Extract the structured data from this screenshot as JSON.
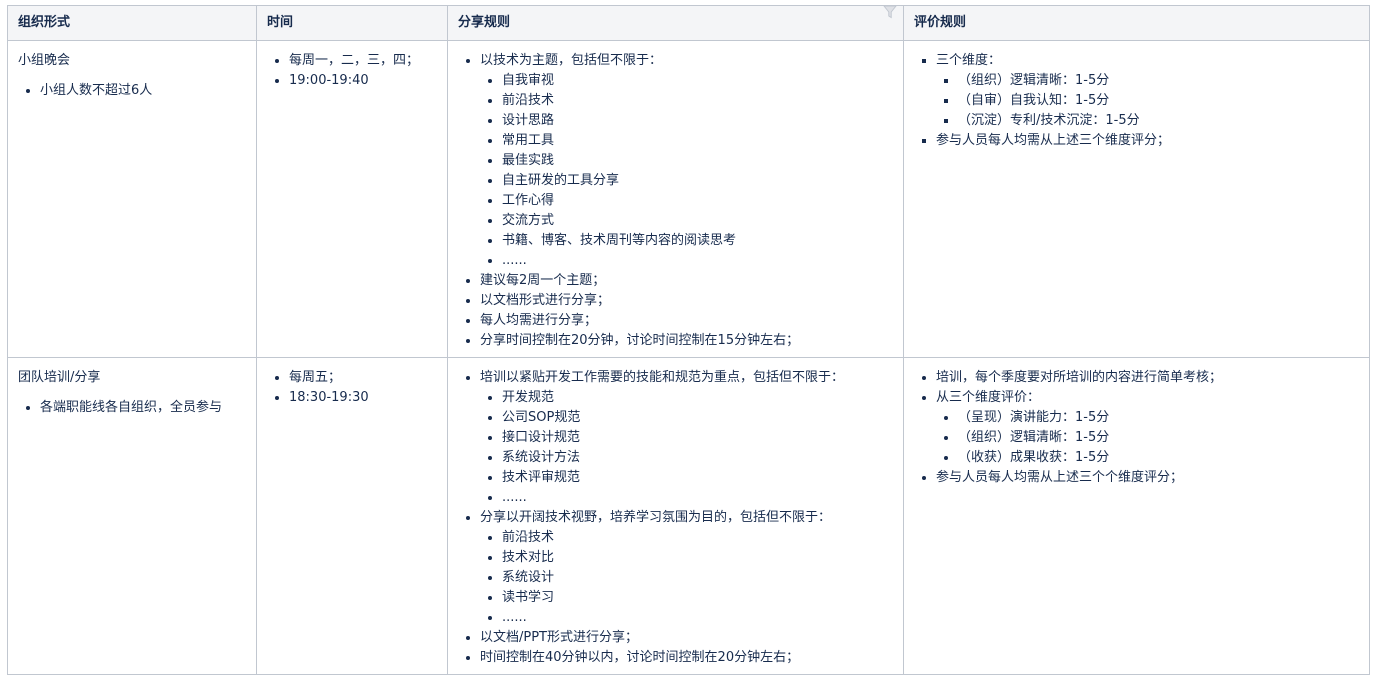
{
  "headers": {
    "col1": "组织形式",
    "col2": "时间",
    "col3": "分享规则",
    "col4": "评价规则"
  },
  "rows": [
    {
      "form_title": "小组晚会",
      "form_items": [
        "小组人数不超过6人"
      ],
      "time_items": [
        "每周一，二，三，四；",
        "19:00-19:40"
      ],
      "share_rules": [
        {
          "text": "以技术为主题，包括但不限于：",
          "children": [
            "自我审视",
            "前沿技术",
            "设计思路",
            "常用工具",
            "最佳实践",
            "自主研发的工具分享",
            "工作心得",
            "交流方式",
            "书籍、博客、技术周刊等内容的阅读思考",
            "......"
          ]
        },
        {
          "text": "建议每2周一个主题；"
        },
        {
          "text": "以文档形式进行分享；"
        },
        {
          "text": "每人均需进行分享；"
        },
        {
          "text": "分享时间控制在20分钟，讨论时间控制在15分钟左右；"
        }
      ],
      "eval_rules": [
        {
          "text": "三个维度：",
          "children": [
            "（组织）逻辑清晰：1-5分",
            "（自审）自我认知：1-5分",
            "（沉淀）专利/技术沉淀：1-5分"
          ]
        },
        {
          "text": "参与人员每人均需从上述三个维度评分；"
        }
      ]
    },
    {
      "form_title": "团队培训/分享",
      "form_items": [
        "各端职能线各自组织，全员参与"
      ],
      "time_items": [
        "每周五；",
        "18:30-19:30"
      ],
      "share_rules": [
        {
          "text": "培训以紧贴开发工作需要的技能和规范为重点，包括但不限于：",
          "children": [
            "开发规范",
            "公司SOP规范",
            "接口设计规范",
            "系统设计方法",
            "技术评审规范",
            "......"
          ]
        },
        {
          "text": "分享以开阔技术视野，培养学习氛围为目的，包括但不限于：",
          "children": [
            "前沿技术",
            "技术对比",
            "系统设计",
            "读书学习",
            "......"
          ]
        },
        {
          "text": "以文档/PPT形式进行分享；"
        },
        {
          "text": "时间控制在40分钟以内，讨论时间控制在20分钟左右；"
        }
      ],
      "eval_rules": [
        {
          "text": "培训，每个季度要对所培训的内容进行简单考核；"
        },
        {
          "text": "从三个维度评价：",
          "children": [
            "（呈现）演讲能力：1-5分",
            "（组织）逻辑清晰：1-5分",
            "（收获）成果收获：1-5分"
          ]
        },
        {
          "text": "参与人员每人均需从上述三个个维度评分；"
        }
      ]
    }
  ],
  "icons": {
    "filter": "filter-icon"
  }
}
